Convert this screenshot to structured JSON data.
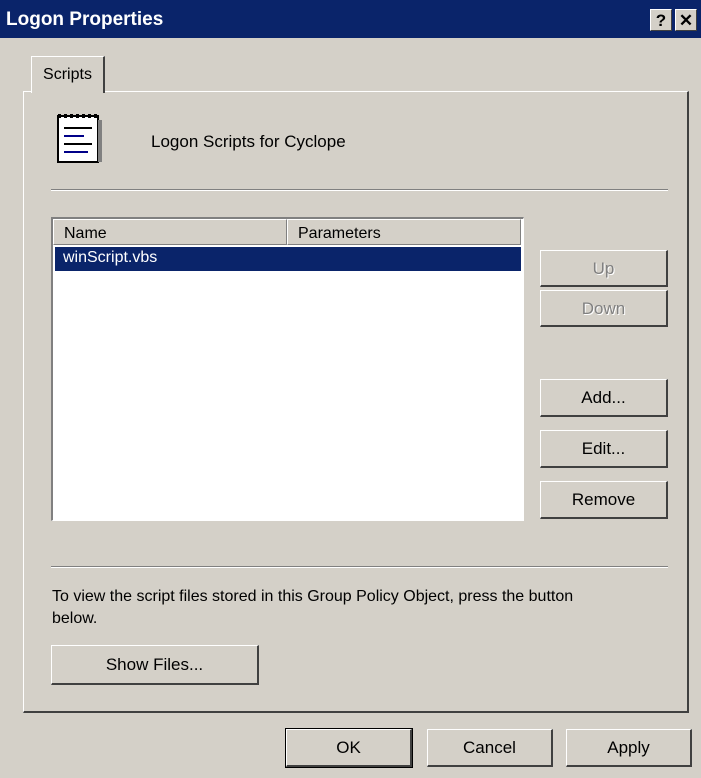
{
  "window": {
    "title": "Logon Properties",
    "help_glyph": "?",
    "close_glyph": "✕"
  },
  "tabs": [
    {
      "label": "Scripts"
    }
  ],
  "header": {
    "text": "Logon Scripts for Cyclope",
    "icon": "script-icon"
  },
  "list": {
    "columns": [
      "Name",
      "Parameters"
    ],
    "rows": [
      {
        "name": "winScript.vbs",
        "parameters": ""
      }
    ]
  },
  "side_buttons": {
    "up": "Up",
    "down": "Down",
    "add": "Add...",
    "edit": "Edit...",
    "remove": "Remove"
  },
  "note": "To view the script files stored in this Group Policy Object, press the button below.",
  "show_files": "Show Files...",
  "footer": {
    "ok": "OK",
    "cancel": "Cancel",
    "apply": "Apply"
  },
  "colors": {
    "titlebar": "#0a246a",
    "face": "#d4d0c8",
    "selection": "#0a246a"
  }
}
